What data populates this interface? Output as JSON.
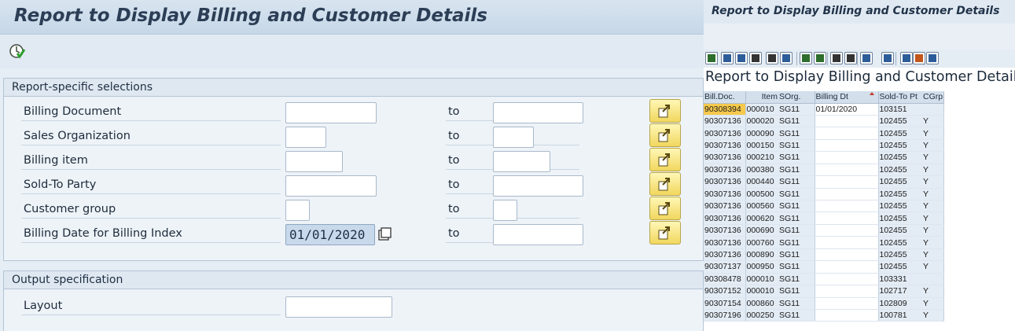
{
  "selection_screen": {
    "title": "Report to Display Billing and Customer Details",
    "group_selections_title": "Report-specific selections",
    "group_output_title": "Output specification",
    "to_label": "to",
    "rows": [
      {
        "label": "Billing Document",
        "low": "",
        "high": ""
      },
      {
        "label": "Sales Organization",
        "low": "",
        "high": ""
      },
      {
        "label": "Billing item",
        "low": "",
        "high": ""
      },
      {
        "label": "Sold-To Party",
        "low": "",
        "high": ""
      },
      {
        "label": "Customer group",
        "low": "",
        "high": ""
      },
      {
        "label": "Billing Date for Billing Index",
        "low": "01/01/2020",
        "high": ""
      }
    ],
    "layout_label": "Layout",
    "layout_value": ""
  },
  "result_screen": {
    "window_title": "Report to Display Billing and Customer Details",
    "heading": "Report to Display Billing and Customer Details",
    "toolbar_icons": [
      "detail-icon",
      "sort-ascending-icon",
      "sort-descending-icon",
      "find-icon",
      "find-next-icon",
      "filter-icon",
      "sum-icon",
      "subtotal-icon",
      "print-icon",
      "print-preview-icon",
      "export-icon",
      "layout-icon",
      "abc-analysis-icon",
      "graphic-icon",
      "info-icon"
    ],
    "columns": [
      "Bill.Doc.",
      "Item",
      "SOrg.",
      "Billing Dt",
      "Sold-To Pt",
      "CGrp"
    ],
    "rows": [
      {
        "doc": "90308394",
        "item": "000010",
        "sorg": "SG11",
        "date": "01/01/2020",
        "sold": "103151",
        "cgrp": ""
      },
      {
        "doc": "90307136",
        "item": "000020",
        "sorg": "SG11",
        "date": "",
        "sold": "102455",
        "cgrp": "Y"
      },
      {
        "doc": "90307136",
        "item": "000090",
        "sorg": "SG11",
        "date": "",
        "sold": "102455",
        "cgrp": "Y"
      },
      {
        "doc": "90307136",
        "item": "000150",
        "sorg": "SG11",
        "date": "",
        "sold": "102455",
        "cgrp": "Y"
      },
      {
        "doc": "90307136",
        "item": "000210",
        "sorg": "SG11",
        "date": "",
        "sold": "102455",
        "cgrp": "Y"
      },
      {
        "doc": "90307136",
        "item": "000380",
        "sorg": "SG11",
        "date": "",
        "sold": "102455",
        "cgrp": "Y"
      },
      {
        "doc": "90307136",
        "item": "000440",
        "sorg": "SG11",
        "date": "",
        "sold": "102455",
        "cgrp": "Y"
      },
      {
        "doc": "90307136",
        "item": "000500",
        "sorg": "SG11",
        "date": "",
        "sold": "102455",
        "cgrp": "Y"
      },
      {
        "doc": "90307136",
        "item": "000560",
        "sorg": "SG11",
        "date": "",
        "sold": "102455",
        "cgrp": "Y"
      },
      {
        "doc": "90307136",
        "item": "000620",
        "sorg": "SG11",
        "date": "",
        "sold": "102455",
        "cgrp": "Y"
      },
      {
        "doc": "90307136",
        "item": "000690",
        "sorg": "SG11",
        "date": "",
        "sold": "102455",
        "cgrp": "Y"
      },
      {
        "doc": "90307136",
        "item": "000760",
        "sorg": "SG11",
        "date": "",
        "sold": "102455",
        "cgrp": "Y"
      },
      {
        "doc": "90307136",
        "item": "000890",
        "sorg": "SG11",
        "date": "",
        "sold": "102455",
        "cgrp": "Y"
      },
      {
        "doc": "90307137",
        "item": "000950",
        "sorg": "SG11",
        "date": "",
        "sold": "102455",
        "cgrp": "Y"
      },
      {
        "doc": "90308478",
        "item": "000010",
        "sorg": "SG11",
        "date": "",
        "sold": "103331",
        "cgrp": ""
      },
      {
        "doc": "90307152",
        "item": "000010",
        "sorg": "SG11",
        "date": "",
        "sold": "102717",
        "cgrp": "Y"
      },
      {
        "doc": "90307154",
        "item": "000860",
        "sorg": "SG11",
        "date": "",
        "sold": "102809",
        "cgrp": "Y"
      },
      {
        "doc": "90307196",
        "item": "000250",
        "sorg": "SG11",
        "date": "",
        "sold": "100781",
        "cgrp": "Y"
      }
    ]
  }
}
